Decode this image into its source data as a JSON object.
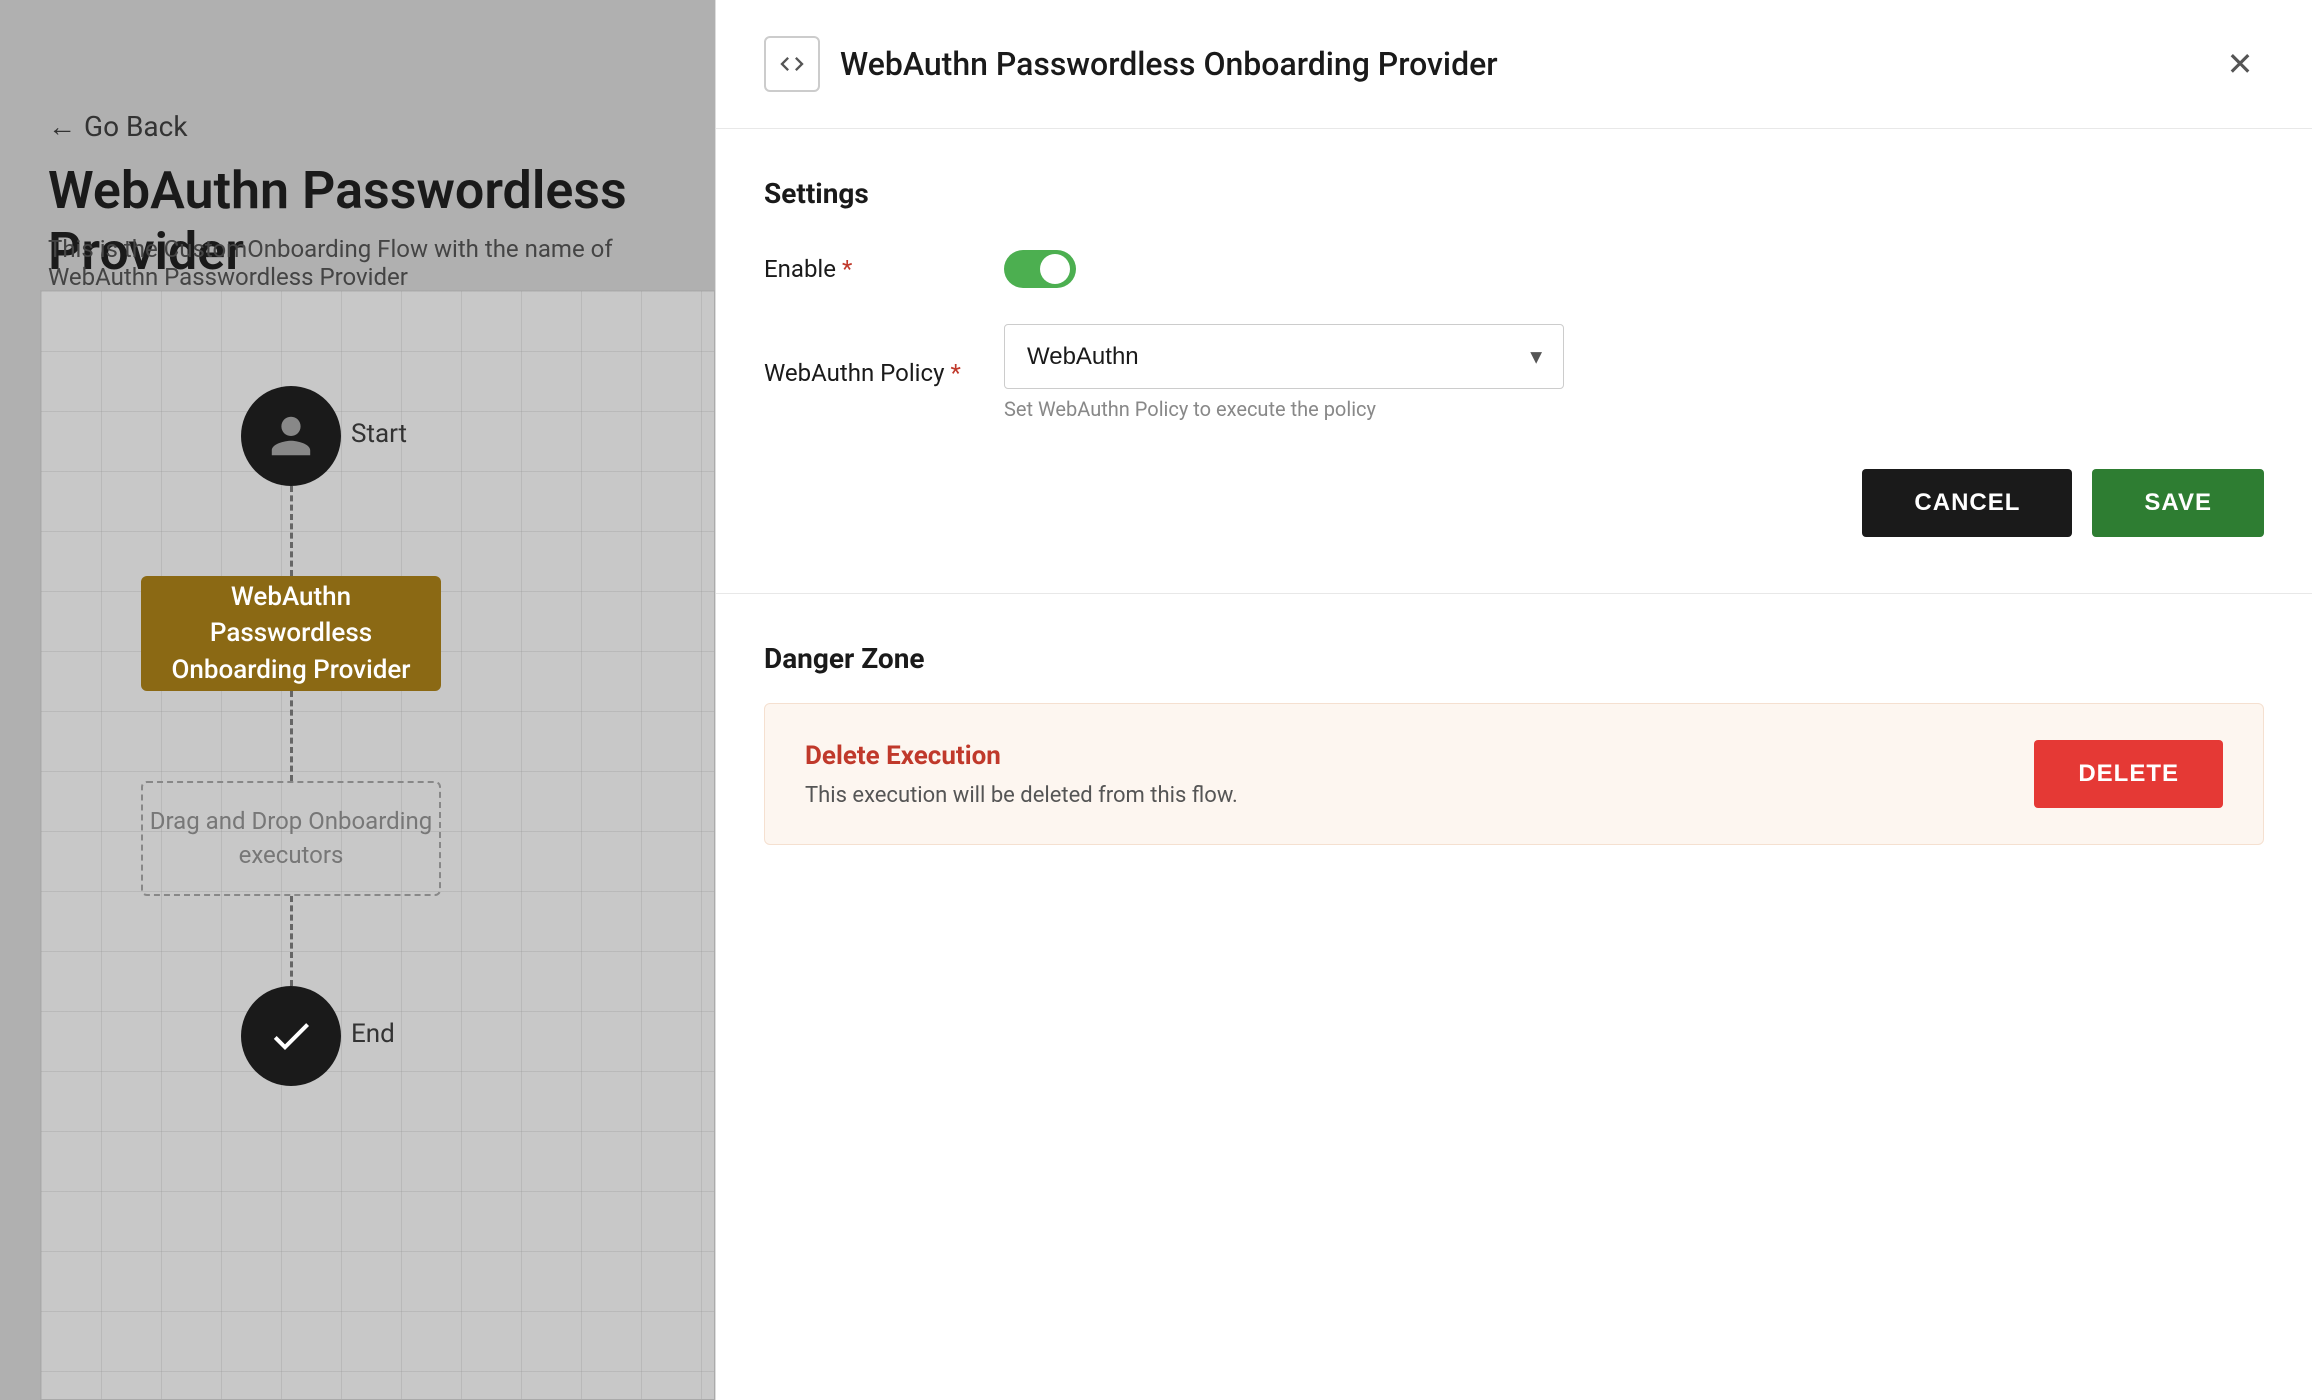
{
  "leftPanel": {
    "goBack": "Go Back",
    "pageTitle": "WebAuthn Passwordless Provider",
    "pageSubtitle": "This is the CustomOnboarding Flow with the name of WebAuthn Passwordless Provider",
    "flowNodes": {
      "startLabel": "Start",
      "mainNodeLine1": "WebAuthn Passwordless",
      "mainNodeLine2": "Onboarding Provider",
      "dropNodeLine1": "Drag and Drop Onboarding",
      "dropNodeLine2": "executors",
      "endLabel": "End"
    }
  },
  "rightPanel": {
    "header": {
      "codeIconAlt": "code-icon",
      "title": "WebAuthn Passwordless Onboarding Provider",
      "closeIconAlt": "close-icon"
    },
    "settings": {
      "sectionTitle": "Settings",
      "enableLabel": "Enable",
      "enableRequired": "*",
      "toggleChecked": true,
      "webAuthnPolicyLabel": "WebAuthn Policy",
      "webAuthnPolicyRequired": "*",
      "dropdownSelected": "WebAuthn",
      "dropdownOptions": [
        "WebAuthn"
      ],
      "dropdownHelp": "Set WebAuthn Policy to execute the policy",
      "cancelLabel": "CANCEL",
      "saveLabel": "SAVE"
    },
    "dangerZone": {
      "sectionTitle": "Danger Zone",
      "deleteTitle": "Delete Execution",
      "deleteDescription": "This execution will be deleted from this flow.",
      "deleteLabel": "DELETE"
    }
  }
}
